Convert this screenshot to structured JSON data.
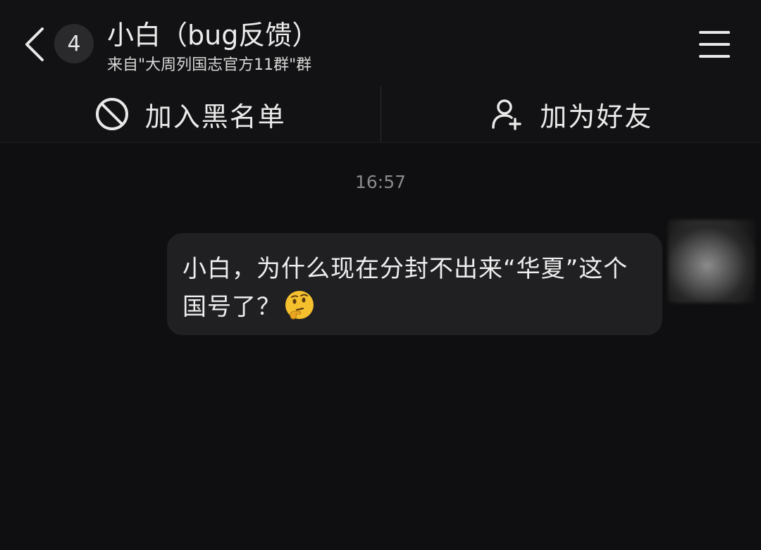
{
  "header": {
    "back_icon": "chevron-left-icon",
    "unread_count": "4",
    "title": "小白（bug反馈）",
    "subtitle": "来自\"大周列国志官方11群\"群",
    "menu_icon": "hamburger-menu-icon"
  },
  "actions": {
    "blacklist": {
      "label": "加入黑名单",
      "icon": "block-icon"
    },
    "add_friend": {
      "label": "加为好友",
      "icon": "add-user-icon"
    }
  },
  "chat": {
    "timestamp": "16:57",
    "messages": [
      {
        "text": "小白，为什么现在分封不出来“华夏”这个国号了？",
        "emoji": "thinking-face-emoji"
      }
    ]
  },
  "colors": {
    "background": "#0f0f11",
    "header_background": "#121214",
    "bubble_background": "#202023",
    "timestamp_text": "#8a8a8d"
  }
}
